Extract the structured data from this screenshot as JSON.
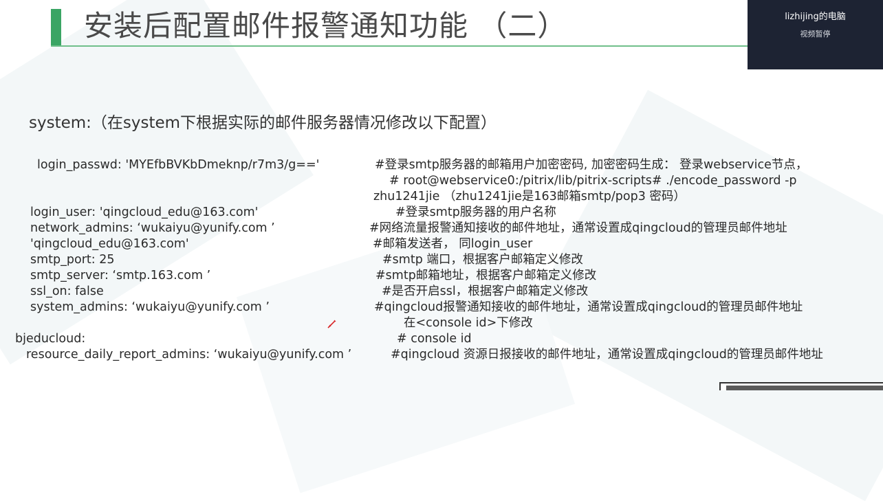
{
  "slide": {
    "title": "安装后配置邮件报警通知功能 （二）",
    "subtitle": "system:（在system下根据实际的邮件服务器情况修改以下配置）"
  },
  "config_lines": [
    "login_passwd: 'MYEfbBVKbDmeknp/r7m3/g=='",
    "#登录smtp服务器的邮箱用户加密密码, 加密密码生成： 登录webservice节点，",
    "# root@webservice0:/pitrix/lib/pitrix-scripts# ./encode_password -p",
    "zhu1241jie （zhu1241jie是163邮箱smtp/pop3 密码）",
    "login_user: 'qingcloud_edu@163.com'",
    "#登录smtp服务器的用户名称",
    "network_admins: ‘wukaiyu@yunify.com ’",
    "#网络流量报警通知接收的邮件地址，通常设置成qingcloud的管理员邮件地址",
    "'qingcloud_edu@163.com'",
    "#邮箱发送者， 同login_user",
    "smtp_port: 25",
    "#smtp 端口，根据客户邮箱定义修改",
    "smtp_server: ‘smtp.163.com ’",
    "#smtp邮箱地址，根据客户邮箱定义修改",
    "ssl_on: false",
    "#是否开启ssl，根据客户邮箱定义修改",
    "system_admins: ‘wukaiyu@yunify.com ’",
    "#qingcloud报警通知接收的邮件地址，通常设置成qingcloud的管理员邮件地址",
    "在<console id>下修改",
    "bjeducloud:",
    "# console id",
    "resource_daily_report_admins: ‘wukaiyu@yunify.com ’",
    "#qingcloud 资源日报接收的邮件地址，通常设置成qingcloud的管理员邮件地址"
  ],
  "video_overlay": {
    "user": "lizhijing的电脑",
    "status": "视频暂停"
  },
  "colors": {
    "accent": "#3aa564",
    "overlay_bg": "#1d2333",
    "pen": "#d8292b"
  },
  "icons": {
    "pen": "pen-cursor-icon"
  }
}
